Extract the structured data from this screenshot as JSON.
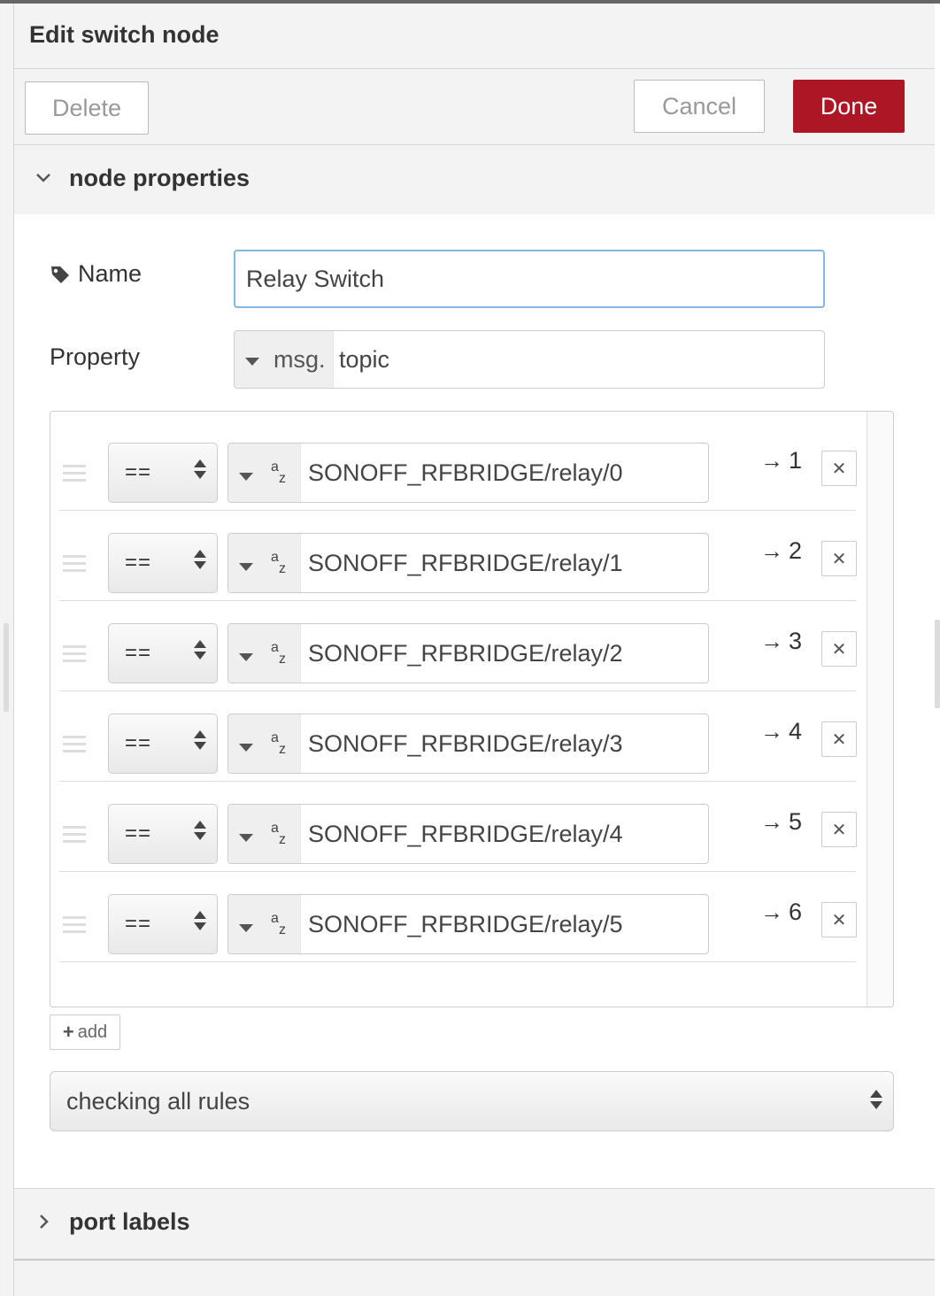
{
  "header": {
    "title": "Edit switch node"
  },
  "toolbar": {
    "delete_label": "Delete",
    "cancel_label": "Cancel",
    "done_label": "Done"
  },
  "colors": {
    "done_button": "#ad1625",
    "focus_border": "#85b7e3",
    "panel_bg": "#f3f3f3"
  },
  "sections": {
    "node_properties": "node properties",
    "port_labels": "port labels"
  },
  "form": {
    "name_label": "Name",
    "name_value": "Relay Switch",
    "property_label": "Property",
    "property_type": "msg.",
    "property_value": "topic"
  },
  "rules": [
    {
      "operator": "==",
      "value": "SONOFF_RFBRIDGE/relay/0",
      "port": "1"
    },
    {
      "operator": "==",
      "value": "SONOFF_RFBRIDGE/relay/1",
      "port": "2"
    },
    {
      "operator": "==",
      "value": "SONOFF_RFBRIDGE/relay/2",
      "port": "3"
    },
    {
      "operator": "==",
      "value": "SONOFF_RFBRIDGE/relay/3",
      "port": "4"
    },
    {
      "operator": "==",
      "value": "SONOFF_RFBRIDGE/relay/4",
      "port": "5"
    },
    {
      "operator": "==",
      "value": "SONOFF_RFBRIDGE/relay/5",
      "port": "6"
    }
  ],
  "rule_type_icon": {
    "a": "a",
    "z": "z"
  },
  "port_arrow": "→",
  "add_label": "add",
  "checking": {
    "selected": "checking all rules"
  },
  "icons": {
    "tag": "tag-icon",
    "chevron_down": "chevron-down-icon",
    "chevron_right": "chevron-right-icon",
    "drag": "drag-handle-icon",
    "remove": "remove-icon",
    "plus": "plus-icon"
  }
}
